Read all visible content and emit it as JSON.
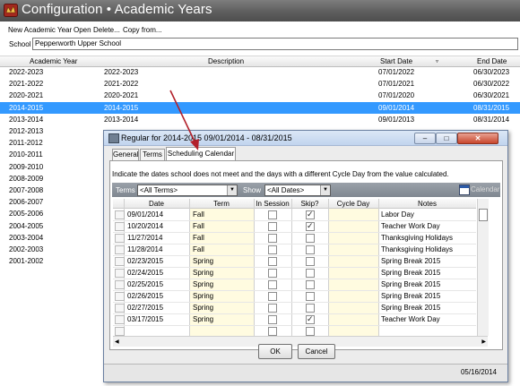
{
  "window": {
    "title": "Configuration • Academic Years"
  },
  "menu": {
    "items": [
      "New Academic Year",
      "Open",
      "Delete...",
      "Copy from..."
    ]
  },
  "school": {
    "label": "School",
    "value": "Pepperworth Upper School"
  },
  "grid": {
    "columns": [
      "Academic Year",
      "Description",
      "Start Date",
      "End Date"
    ],
    "rows": [
      {
        "year": "2022-2023",
        "description": "2022-2023",
        "start": "07/01/2022",
        "end": "06/30/2023"
      },
      {
        "year": "2021-2022",
        "description": "2021-2022",
        "start": "07/01/2021",
        "end": "06/30/2022"
      },
      {
        "year": "2020-2021",
        "description": "2020-2021",
        "start": "07/01/2020",
        "end": "06/30/2021"
      },
      {
        "year": "2014-2015",
        "description": "2014-2015",
        "start": "09/01/2014",
        "end": "08/31/2015"
      },
      {
        "year": "2013-2014",
        "description": "2013-2014",
        "start": "09/01/2013",
        "end": "08/31/2014"
      },
      {
        "year": "2012-2013",
        "description": "",
        "start": "",
        "end": ""
      },
      {
        "year": "2011-2012",
        "description": "",
        "start": "",
        "end": ""
      },
      {
        "year": "2010-2011",
        "description": "",
        "start": "",
        "end": ""
      },
      {
        "year": "2009-2010",
        "description": "",
        "start": "",
        "end": ""
      },
      {
        "year": "2008-2009",
        "description": "",
        "start": "",
        "end": ""
      },
      {
        "year": "2007-2008",
        "description": "",
        "start": "",
        "end": ""
      },
      {
        "year": "2006-2007",
        "description": "",
        "start": "",
        "end": ""
      },
      {
        "year": "2005-2006",
        "description": "",
        "start": "",
        "end": ""
      },
      {
        "year": "2004-2005",
        "description": "",
        "start": "",
        "end": ""
      },
      {
        "year": "2003-2004",
        "description": "",
        "start": "",
        "end": ""
      },
      {
        "year": "2002-2003",
        "description": "",
        "start": "",
        "end": ""
      },
      {
        "year": "2001-2002",
        "description": "",
        "start": "",
        "end": ""
      }
    ],
    "selected_row": 3
  },
  "dialog": {
    "title": "Regular for 2014-2015  09/01/2014 - 08/31/2015",
    "tabs": [
      "General",
      "Terms",
      "Scheduling Calendar"
    ],
    "active_tab": 2,
    "hint": "Indicate the dates school does not meet and the days with a different Cycle Day from the value calculated.",
    "filters": {
      "terms_label": "Terms",
      "terms_value": "<All Terms>",
      "show_label": "Show",
      "show_value": "<All Dates>",
      "calendar_label": "Calendar"
    },
    "table": {
      "columns": [
        "Date",
        "Term",
        "In Session",
        "Skip?",
        "Cycle Day",
        "Notes"
      ],
      "rows": [
        {
          "date": "09/01/2014",
          "term": "Fall",
          "in_session": false,
          "skip": true,
          "cycle_day": "",
          "notes": "Labor Day"
        },
        {
          "date": "10/20/2014",
          "term": "Fall",
          "in_session": false,
          "skip": true,
          "cycle_day": "",
          "notes": "Teacher Work Day"
        },
        {
          "date": "11/27/2014",
          "term": "Fall",
          "in_session": false,
          "skip": false,
          "cycle_day": "",
          "notes": "Thanksgiving Holidays"
        },
        {
          "date": "11/28/2014",
          "term": "Fall",
          "in_session": false,
          "skip": false,
          "cycle_day": "",
          "notes": "Thanksgiving Holidays"
        },
        {
          "date": "02/23/2015",
          "term": "Spring",
          "in_session": false,
          "skip": false,
          "cycle_day": "",
          "notes": "Spring Break 2015"
        },
        {
          "date": "02/24/2015",
          "term": "Spring",
          "in_session": false,
          "skip": false,
          "cycle_day": "",
          "notes": "Spring Break 2015"
        },
        {
          "date": "02/25/2015",
          "term": "Spring",
          "in_session": false,
          "skip": false,
          "cycle_day": "",
          "notes": "Spring Break 2015"
        },
        {
          "date": "02/26/2015",
          "term": "Spring",
          "in_session": false,
          "skip": false,
          "cycle_day": "",
          "notes": "Spring Break 2015"
        },
        {
          "date": "02/27/2015",
          "term": "Spring",
          "in_session": false,
          "skip": false,
          "cycle_day": "",
          "notes": "Spring Break 2015"
        },
        {
          "date": "03/17/2015",
          "term": "Spring",
          "in_session": false,
          "skip": true,
          "cycle_day": "",
          "notes": "Teacher Work Day"
        },
        {
          "date": "",
          "term": "",
          "in_session": false,
          "skip": false,
          "cycle_day": "",
          "notes": ""
        }
      ]
    },
    "ok_label": "OK",
    "cancel_label": "Cancel",
    "status_date": "05/16/2014"
  },
  "colors": {
    "selection": "#3399ff",
    "annotation_arrow": "#b2202a",
    "yellow_column": "#fffbe0"
  }
}
